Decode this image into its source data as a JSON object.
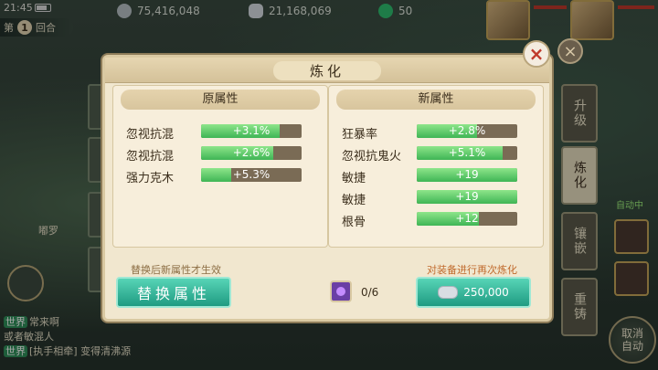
{
  "status": {
    "time": "21:45"
  },
  "resources": [
    {
      "icon": "coin-icon",
      "value": "75,416,048"
    },
    {
      "icon": "silver-icon",
      "value": "21,168,069"
    },
    {
      "icon": "jade-icon",
      "value": "50"
    }
  ],
  "turn": {
    "prefix": "第",
    "number": "1",
    "suffix": "回合"
  },
  "character_name": "嘟罗",
  "chat": [
    {
      "tag": "世界",
      "text": "常来啊"
    },
    {
      "tag": "",
      "text": "或者敏混人"
    },
    {
      "tag": "世界",
      "text": "[执手相牵] 变得清沸源"
    }
  ],
  "right_tabs": [
    "升级",
    "炼化",
    "镶嵌",
    "重铸"
  ],
  "auto": {
    "label": "自动中",
    "cancel_line1": "取消",
    "cancel_line2": "自动"
  },
  "modal": {
    "title": "炼化",
    "left_panel_title": "原属性",
    "right_panel_title": "新属性",
    "original": [
      {
        "name": "忽视抗混",
        "value": "+3.1%",
        "fill": 0.78
      },
      {
        "name": "忽视抗混",
        "value": "+2.6%",
        "fill": 0.72
      },
      {
        "name": "强力克木",
        "value": "+5.3%",
        "fill": 0.3
      }
    ],
    "new": [
      {
        "name": "狂暴率",
        "value": "+2.8%",
        "fill": 0.6
      },
      {
        "name": "忽视抗鬼火",
        "value": "+5.1%",
        "fill": 0.85
      },
      {
        "name": "敏捷",
        "value": "+19",
        "fill": 1.0
      },
      {
        "name": "敏捷",
        "value": "+19",
        "fill": 1.0
      },
      {
        "name": "根骨",
        "value": "+12",
        "fill": 0.62
      }
    ],
    "note_left": "替换后新属性才生效",
    "note_right": "对装备进行再次炼化",
    "replace_button": "替换属性",
    "gem_count": "0/6",
    "refine_cost": "250,000"
  },
  "colors": {
    "bar_fill": "#3fb555",
    "button": "#1f9b82",
    "panel_bg": "#f1e7cf"
  }
}
